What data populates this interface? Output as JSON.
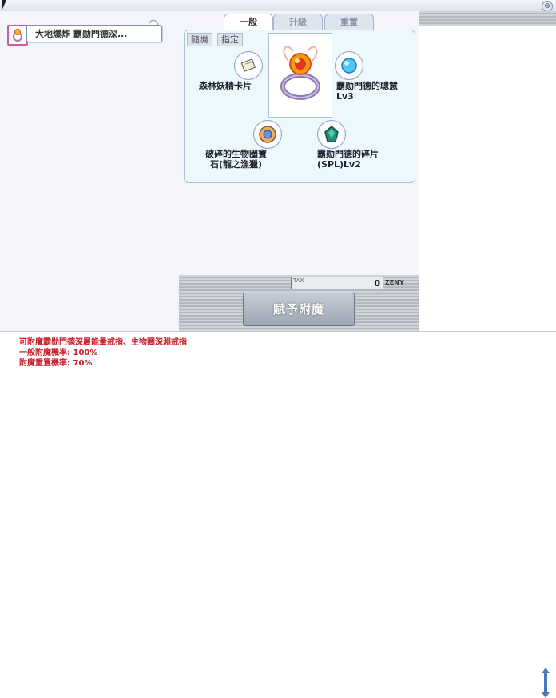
{
  "window": {
    "close_glyph": "⊗"
  },
  "equipment": {
    "slot_icon": "ring-icon",
    "name": "大地爆炸 霸勋門德深..."
  },
  "tabs": [
    {
      "label": "一般",
      "active": true
    },
    {
      "label": "升級",
      "active": false
    },
    {
      "label": "重置",
      "active": false
    }
  ],
  "modes": {
    "random": "隨機",
    "specified": "指定"
  },
  "main_item": {
    "icon": "ring-icon"
  },
  "materials": [
    {
      "icon": "card-icon",
      "label": "森林妖精卡片"
    },
    {
      "icon": "crystal-icon",
      "label": "霸勋門德的聰慧\nLv3"
    },
    {
      "icon": "gem-icon",
      "label": "破碎的生物圈寶\n石(龍之漁獵)"
    },
    {
      "icon": "shard-icon",
      "label": "霸勋門德的碎片\n(SPL)Lv2"
    }
  ],
  "tax": {
    "label": "TAX",
    "value": "0",
    "currency": "ZENY"
  },
  "enchant_button": "賦予附魔",
  "info": {
    "line1": "可附魔霸勋門德深層能量戒指、生物圈深淵戒指",
    "line2": "一般附魔機率: 100%",
    "line3": "附魔重置機率: 70%"
  },
  "colors": {
    "info_text": "#c81e28",
    "tab_active_bg": "#ffffff",
    "card_bg": "#ecf8fc",
    "slot_border": "#d05a9d"
  }
}
